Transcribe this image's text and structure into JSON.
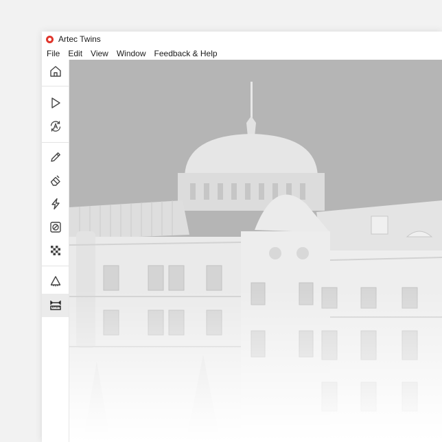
{
  "app": {
    "title": "Artec Twins",
    "logo_icon": "artec-logo-icon",
    "accent_color": "#e0352b"
  },
  "menu": {
    "items": [
      {
        "label": "File"
      },
      {
        "label": "Edit"
      },
      {
        "label": "View"
      },
      {
        "label": "Window"
      },
      {
        "label": "Feedback & Help"
      }
    ]
  },
  "toolbar": {
    "tools": [
      {
        "icon": "home-icon"
      },
      {
        "icon": "play-icon"
      },
      {
        "icon": "autopilot-icon"
      },
      {
        "icon": "pencil-icon"
      },
      {
        "icon": "eraser-icon"
      },
      {
        "icon": "lightning-icon"
      },
      {
        "icon": "no-entry-icon"
      },
      {
        "icon": "texture-checker-icon"
      },
      {
        "icon": "cone-icon"
      },
      {
        "icon": "measure-icon",
        "active": true
      }
    ]
  },
  "viewport": {
    "content": "3d-model-building",
    "background_color": "#b5b5b5"
  }
}
